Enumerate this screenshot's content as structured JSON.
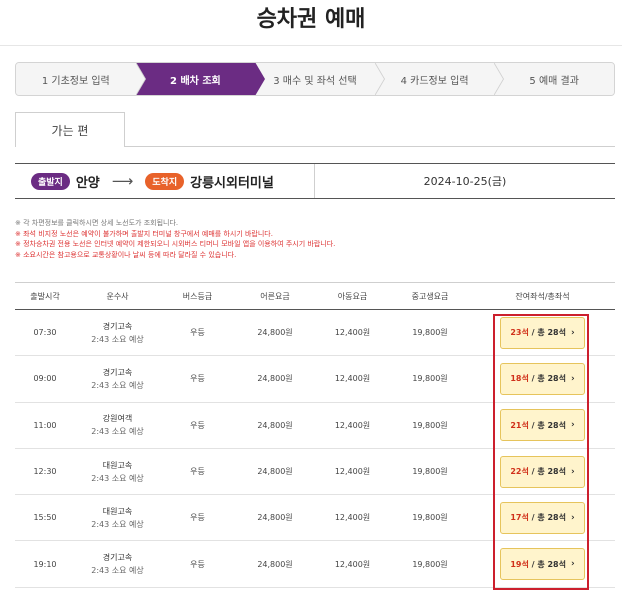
{
  "page": {
    "title": "승차권 예매"
  },
  "steps": [
    {
      "label": "1 기초정보 입력",
      "active": false
    },
    {
      "label": "2 배차 조회",
      "active": true
    },
    {
      "label": "3 매수 및 좌석 선택",
      "active": false
    },
    {
      "label": "4 카드정보 입력",
      "active": false
    },
    {
      "label": "5 예매 결과",
      "active": false
    }
  ],
  "tab": {
    "label": "가는 편"
  },
  "route": {
    "departure_badge": "출발지",
    "departure": "안양",
    "arrow": "⟶",
    "arrival_badge": "도착지",
    "arrival": "강릉시외터미널",
    "date": "2024-10-25(금)"
  },
  "notes": [
    {
      "text": "※ 각 차편정보를 클릭하시면 상세 노선도가 조회됩니다.",
      "color": "gray"
    },
    {
      "text": "※ 좌석 비지정 노선은 예약이 불가하며 출발지 터미널 창구에서 예매를 하시기 바랍니다.",
      "color": "red"
    },
    {
      "text": "※ 정차승차권 전용 노선은 인터넷 예약이 제한되오니 시외버스 티머니 모바일 앱을 이용하여 주시기 바랍니다.",
      "color": "red"
    },
    {
      "text": "※ 소요시간은 참고용으로 교통상황이나 날씨 등에 따라 달라질 수 있습니다.",
      "color": "red"
    }
  ],
  "table": {
    "headers": [
      "출발시각",
      "운수사",
      "버스등급",
      "어른요금",
      "아동요금",
      "중고생요금",
      "잔여좌석/총좌석"
    ],
    "rows": [
      {
        "time": "07:30",
        "company": "경기고속",
        "duration": "2:43 소요 예상",
        "grade": "우등",
        "adult": "24,800원",
        "child": "12,400원",
        "student": "19,800원",
        "remaining": "23석",
        "total": "/ 총 28석"
      },
      {
        "time": "09:00",
        "company": "경기고속",
        "duration": "2:43 소요 예상",
        "grade": "우등",
        "adult": "24,800원",
        "child": "12,400원",
        "student": "19,800원",
        "remaining": "18석",
        "total": "/ 총 28석"
      },
      {
        "time": "11:00",
        "company": "강원여객",
        "duration": "2:43 소요 예상",
        "grade": "우등",
        "adult": "24,800원",
        "child": "12,400원",
        "student": "19,800원",
        "remaining": "21석",
        "total": "/ 총 28석"
      },
      {
        "time": "12:30",
        "company": "대원고속",
        "duration": "2:43 소요 예상",
        "grade": "우등",
        "adult": "24,800원",
        "child": "12,400원",
        "student": "19,800원",
        "remaining": "22석",
        "total": "/ 총 28석"
      },
      {
        "time": "15:50",
        "company": "대원고속",
        "duration": "2:43 소요 예상",
        "grade": "우등",
        "adult": "24,800원",
        "child": "12,400원",
        "student": "19,800원",
        "remaining": "17석",
        "total": "/ 총 28석"
      },
      {
        "time": "19:10",
        "company": "경기고속",
        "duration": "2:43 소요 예상",
        "grade": "우등",
        "adult": "24,800원",
        "child": "12,400원",
        "student": "19,800원",
        "remaining": "19석",
        "total": "/ 총 28석"
      }
    ]
  },
  "colors": {
    "accent": "#6b2c83",
    "arrival": "#e8622a",
    "seat_bg": "#fff4cc",
    "highlight": "#cc1f2d"
  },
  "icons": {
    "seat_chevron": "chevron-right-icon"
  }
}
